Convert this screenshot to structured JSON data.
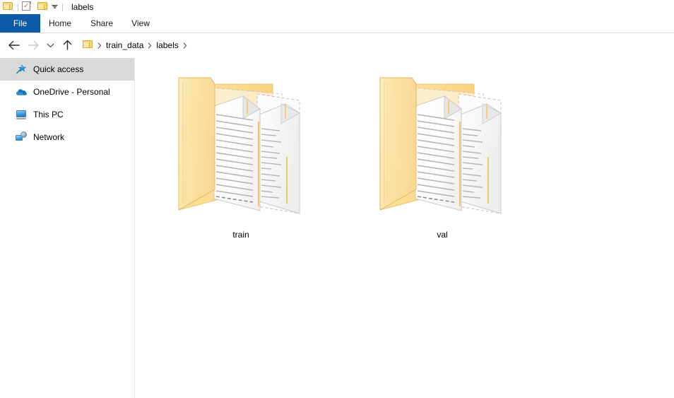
{
  "window": {
    "title": "labels",
    "accent_color": "#0078d7",
    "quick_access_toolbar": [
      {
        "name": "properties-icon",
        "label": "Properties"
      },
      {
        "name": "new-folder-icon",
        "label": "New folder"
      },
      {
        "name": "customize-qat-chevron-icon",
        "label": "Customize Quick Access Toolbar"
      }
    ],
    "system_icon": "folder-icon"
  },
  "ribbon": {
    "tabs": [
      {
        "id": "file",
        "label": "File",
        "selected": true
      },
      {
        "id": "home",
        "label": "Home",
        "selected": false
      },
      {
        "id": "share",
        "label": "Share",
        "selected": false
      },
      {
        "id": "view",
        "label": "View",
        "selected": false
      }
    ],
    "file_tab_color": "#0d5ba6"
  },
  "navigation": {
    "back": {
      "icon": "back-arrow-icon",
      "enabled": true
    },
    "forward": {
      "icon": "forward-arrow-icon",
      "enabled": false
    },
    "recent": {
      "icon": "chevron-down-icon",
      "enabled": true
    },
    "up": {
      "icon": "up-arrow-icon",
      "enabled": true
    },
    "breadcrumb": {
      "root_icon": "folder-icon",
      "segments": [
        "train_data",
        "labels"
      ],
      "separator": "›"
    }
  },
  "sidebar": {
    "items": [
      {
        "label": "Quick access",
        "icon": "pin-star-icon",
        "selected": true
      },
      {
        "label": "OneDrive - Personal",
        "icon": "cloud-icon",
        "selected": false
      },
      {
        "label": "This PC",
        "icon": "monitor-icon",
        "selected": false
      },
      {
        "label": "Network",
        "icon": "network-icon",
        "selected": false
      }
    ]
  },
  "main": {
    "view_mode": "extra-large-icons",
    "items": [
      {
        "name": "train",
        "type": "folder",
        "icon": "folder-with-documents-icon"
      },
      {
        "name": "val",
        "type": "folder",
        "icon": "folder-with-documents-icon"
      }
    ]
  },
  "colors": {
    "folder_front": "#fbdf9f",
    "folder_back": "#fcd98e",
    "selection_gray": "#d9d9d9",
    "divider": "#eaeaea"
  }
}
